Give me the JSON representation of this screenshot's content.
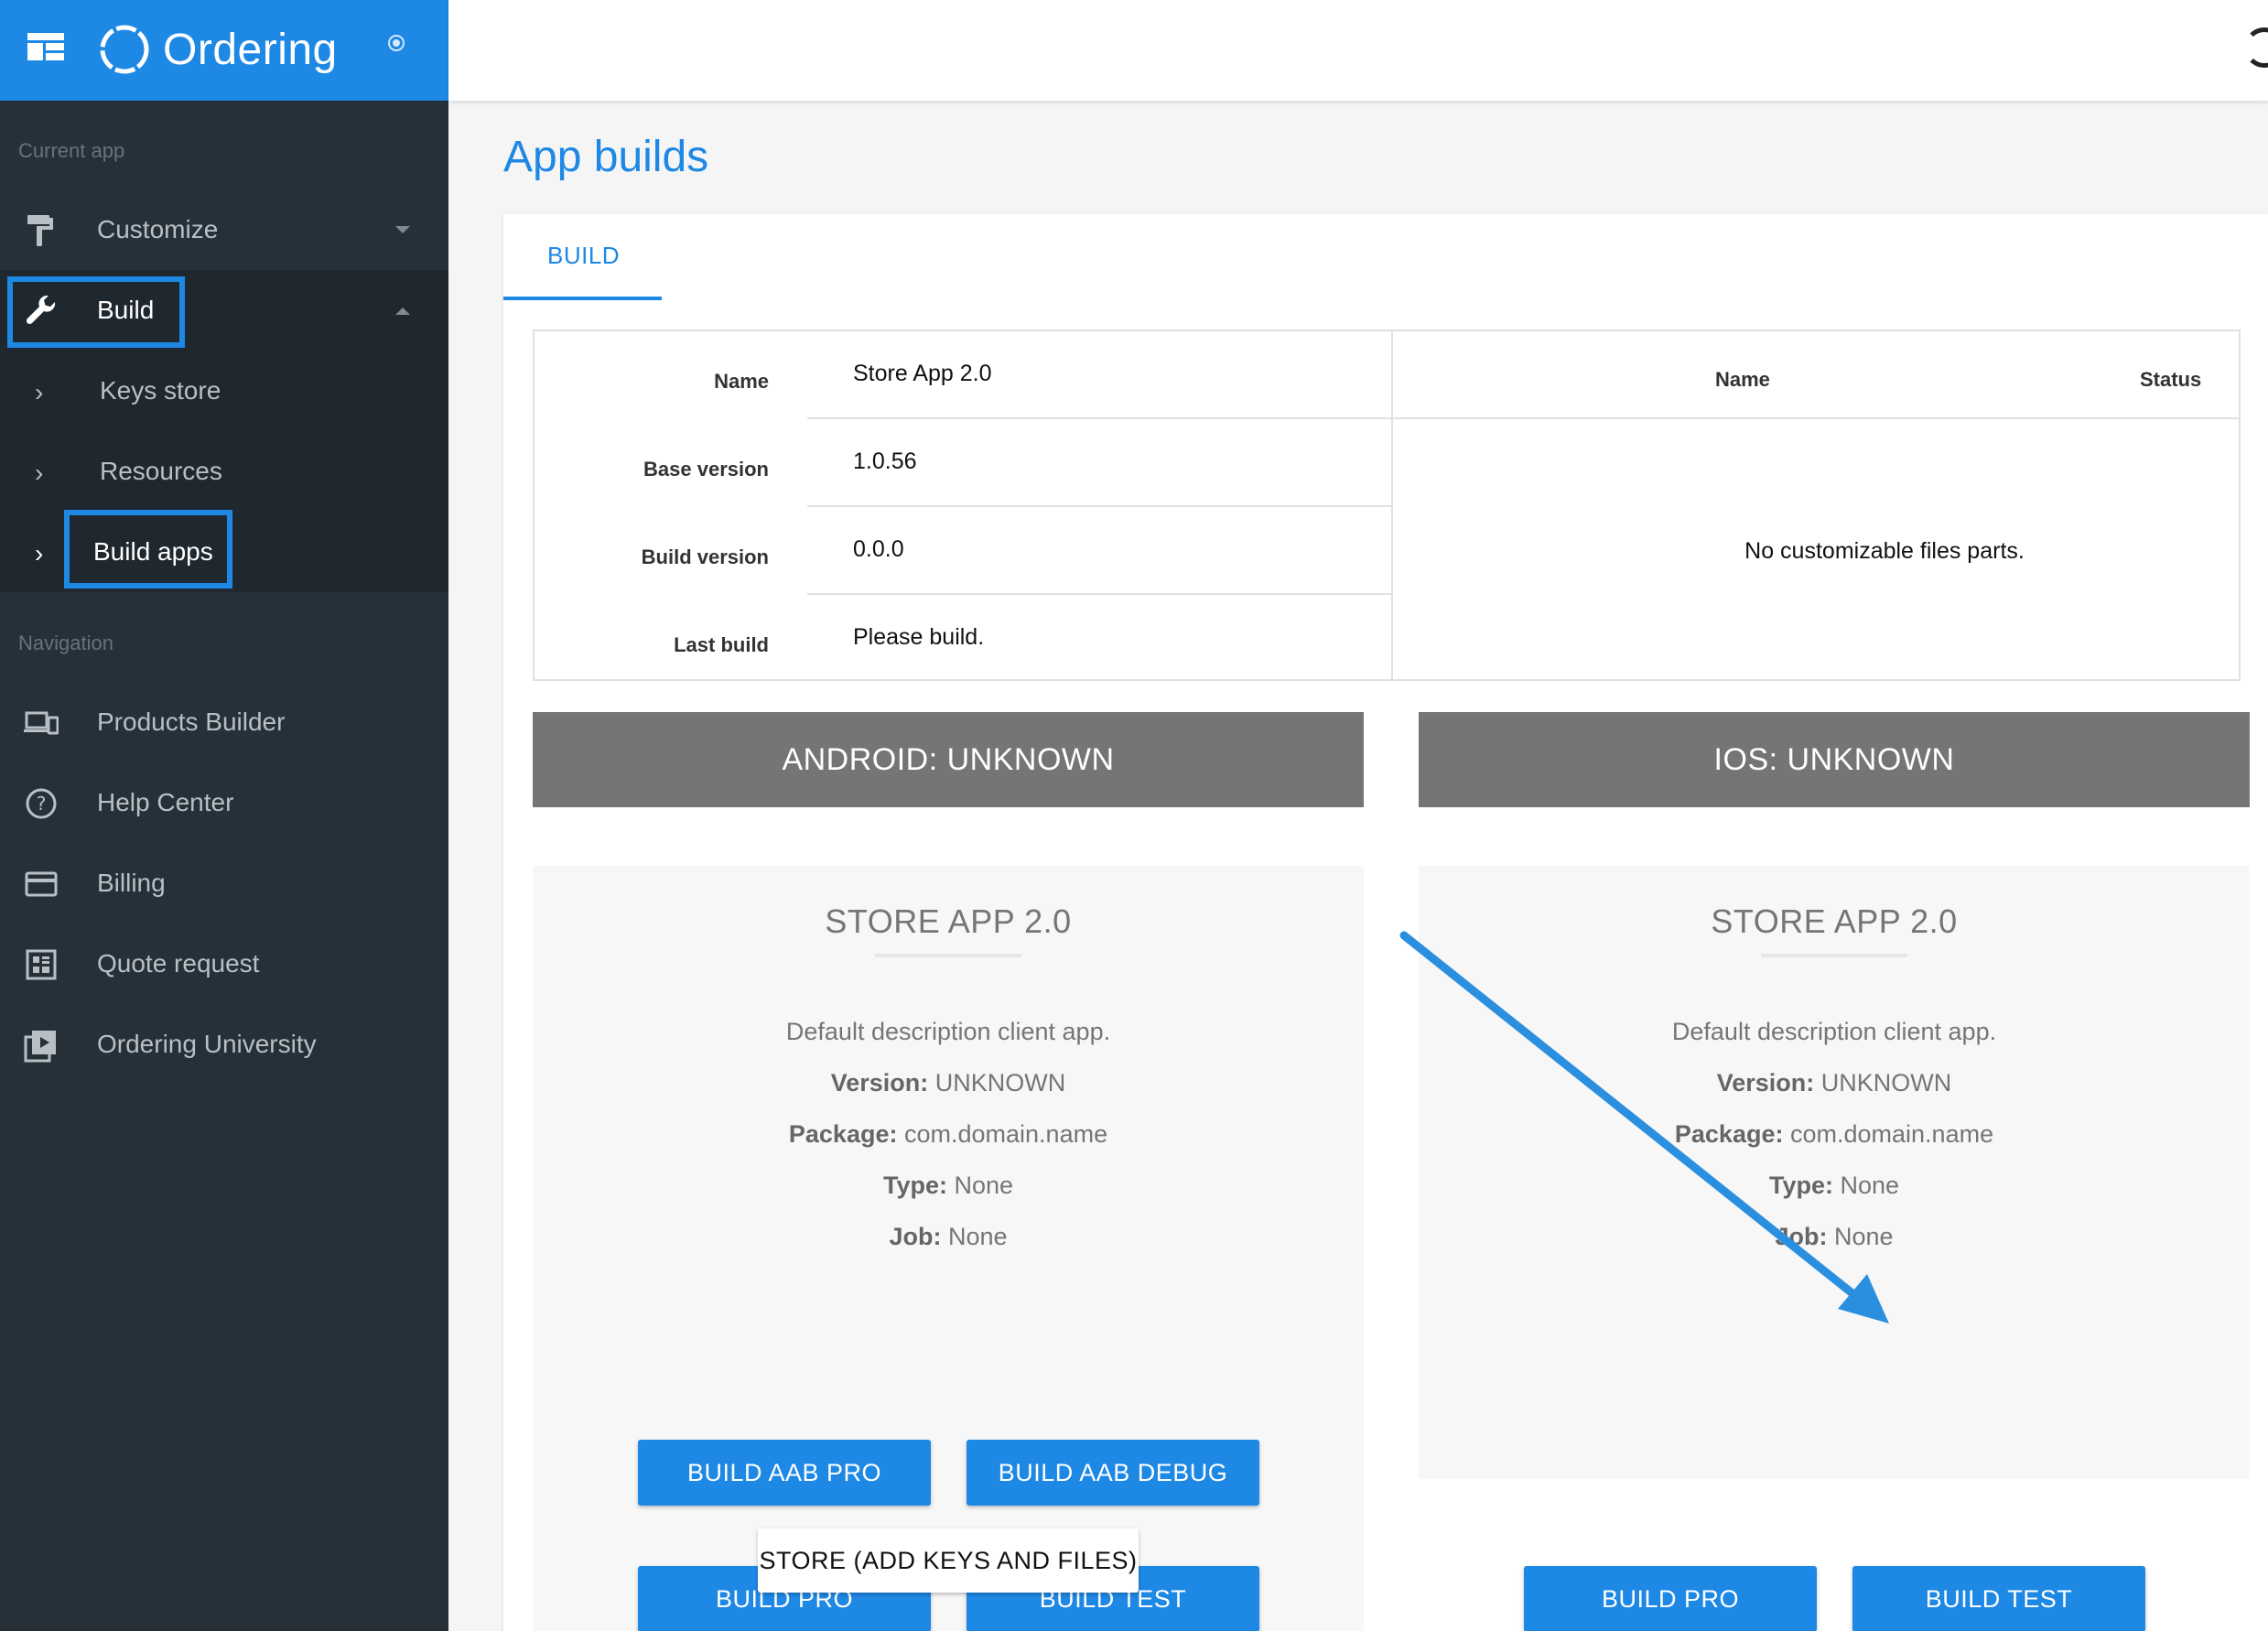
{
  "brand": {
    "name": "Ordering"
  },
  "sidebar": {
    "current_app_label": "Current app",
    "navigation_label": "Navigation",
    "customize": "Customize",
    "build": "Build",
    "build_children": [
      "Keys store",
      "Resources",
      "Build apps"
    ],
    "nav_items": [
      "Products Builder",
      "Help Center",
      "Billing",
      "Quote request",
      "Ordering University"
    ]
  },
  "page": {
    "title": "App builds"
  },
  "tabs": {
    "build": "BUILD"
  },
  "info": {
    "rows": [
      {
        "label": "Name",
        "value": "Store App 2.0"
      },
      {
        "label": "Base version",
        "value": "1.0.56"
      },
      {
        "label": "Build version",
        "value": "0.0.0"
      },
      {
        "label": "Last build",
        "value": "Please build."
      }
    ]
  },
  "files": {
    "col_name": "Name",
    "col_status": "Status",
    "empty": "No customizable files parts."
  },
  "android": {
    "header": "ANDROID: UNKNOWN",
    "title": "STORE APP 2.0",
    "description": "Default description client app.",
    "version_label": "Version:",
    "version": "UNKNOWN",
    "package_label": "Package:",
    "package": "com.domain.name",
    "type_label": "Type:",
    "type": "None",
    "job_label": "Job:",
    "job": "None",
    "btn_build_pro": "BUILD PRO",
    "btn_build_test": "BUILD TEST",
    "btn_build_aab_pro": "BUILD AAB PRO",
    "btn_build_aab_debug": "BUILD AAB DEBUG",
    "btn_store": "STORE (ADD KEYS AND FILES)"
  },
  "ios": {
    "header": "IOS: UNKNOWN",
    "title": "STORE APP 2.0",
    "description": "Default description client app.",
    "version_label": "Version:",
    "version": "UNKNOWN",
    "package_label": "Package:",
    "package": "com.domain.name",
    "type_label": "Type:",
    "type": "None",
    "job_label": "Job:",
    "job": "None",
    "btn_build_pro": "BUILD PRO",
    "btn_build_test": "BUILD TEST"
  },
  "colors": {
    "accent": "#1e88e5",
    "sidebar_bg": "#263038",
    "platform_bar": "#757575"
  }
}
